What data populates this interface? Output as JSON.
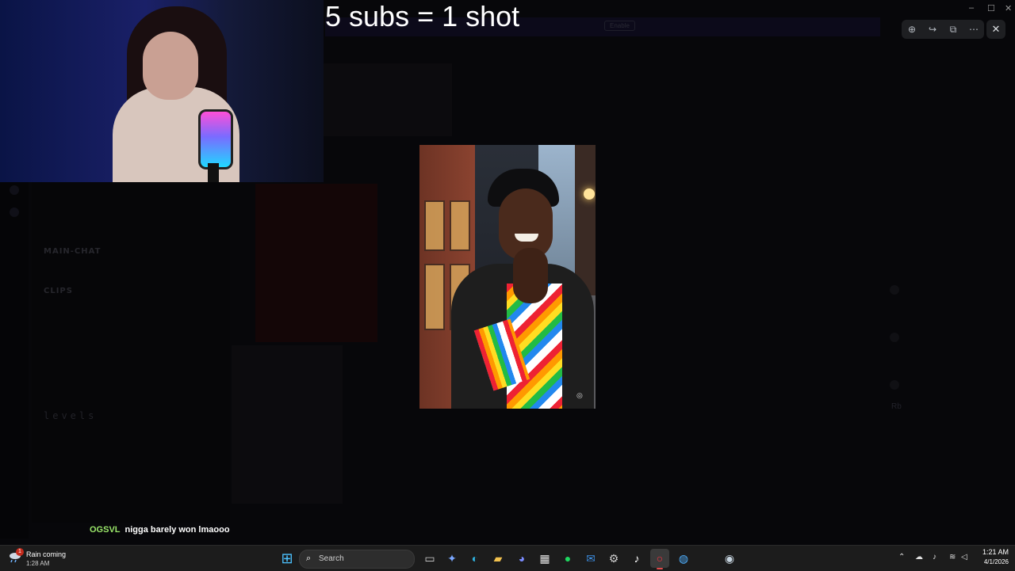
{
  "overlay": {
    "title": "5 subs = 1 shot"
  },
  "background_app": {
    "levels_channel": "levels",
    "member_label": "Rb",
    "banner_button": "Enable",
    "channels": [
      "MAIN-CHAT",
      "CLIPS"
    ]
  },
  "viewer": {
    "controls": [
      {
        "name": "zoom-in-icon",
        "glyph": "⊕"
      },
      {
        "name": "forward-icon",
        "glyph": "↪"
      },
      {
        "name": "open-external-icon",
        "glyph": "⧉"
      },
      {
        "name": "more-icon",
        "glyph": "⋯"
      }
    ],
    "close_glyph": "✕"
  },
  "window_controls": {
    "minimize": "–",
    "maximize": "☐",
    "close": "✕"
  },
  "chat": {
    "username": "OGSVL",
    "message": "nigga barely won lmaooo"
  },
  "taskbar": {
    "weather": {
      "title": "Rain coming",
      "time": "1:28 AM",
      "badge": "1"
    },
    "search_label": "Search",
    "clock": {
      "time": "1:21 AM",
      "date": "4/1/2026"
    },
    "apps": [
      {
        "name": "start-button",
        "glyph": "⊞",
        "color": "#4cc2ff"
      },
      {
        "name": "task-view-icon",
        "glyph": "▭",
        "color": "#d0d0d0"
      },
      {
        "name": "copilot-icon",
        "glyph": "✦",
        "color": "#7aa7ff"
      },
      {
        "name": "edge-icon",
        "glyph": "◐",
        "color": "#2fb3e0"
      },
      {
        "name": "file-explorer-icon",
        "glyph": "▰",
        "color": "#f2c14e"
      },
      {
        "name": "discord-icon",
        "glyph": "◕",
        "color": "#7b8cff"
      },
      {
        "name": "store-icon",
        "glyph": "▦",
        "color": "#e0e0e0"
      },
      {
        "name": "spotify-icon",
        "glyph": "●",
        "color": "#1ed760"
      },
      {
        "name": "mail-icon",
        "glyph": "✉",
        "color": "#3c8de0"
      },
      {
        "name": "settings-icon",
        "glyph": "⚙",
        "color": "#cfcfcf"
      },
      {
        "name": "tiktok-icon",
        "glyph": "♪",
        "color": "#ffffff"
      },
      {
        "name": "opera-icon",
        "glyph": "○",
        "color": "#ff3040"
      },
      {
        "name": "browser-icon",
        "glyph": "◍",
        "color": "#4fb0ff"
      },
      {
        "name": "steam-icon",
        "glyph": "◉",
        "color": "#c7d5e0"
      }
    ],
    "tray": [
      {
        "name": "chevron-up-icon",
        "glyph": "⌃"
      },
      {
        "name": "onedrive-icon",
        "glyph": "☁"
      },
      {
        "name": "microphone-icon",
        "glyph": "♪"
      },
      {
        "name": "wifi-icon",
        "glyph": "≋"
      },
      {
        "name": "volume-icon",
        "glyph": "◁"
      }
    ]
  }
}
